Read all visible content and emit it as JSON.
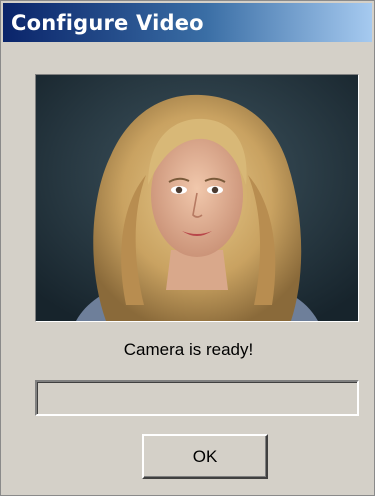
{
  "window": {
    "title": "Configure Video"
  },
  "video": {
    "icon": "webcam-preview-image"
  },
  "status": {
    "text": "Camera is ready!"
  },
  "progress": {
    "value": 0
  },
  "buttons": {
    "ok_label": "OK"
  },
  "colors": {
    "titlebar_start": "#0a246a",
    "titlebar_end": "#a6caf0",
    "dialog_face": "#d4d0c8"
  }
}
